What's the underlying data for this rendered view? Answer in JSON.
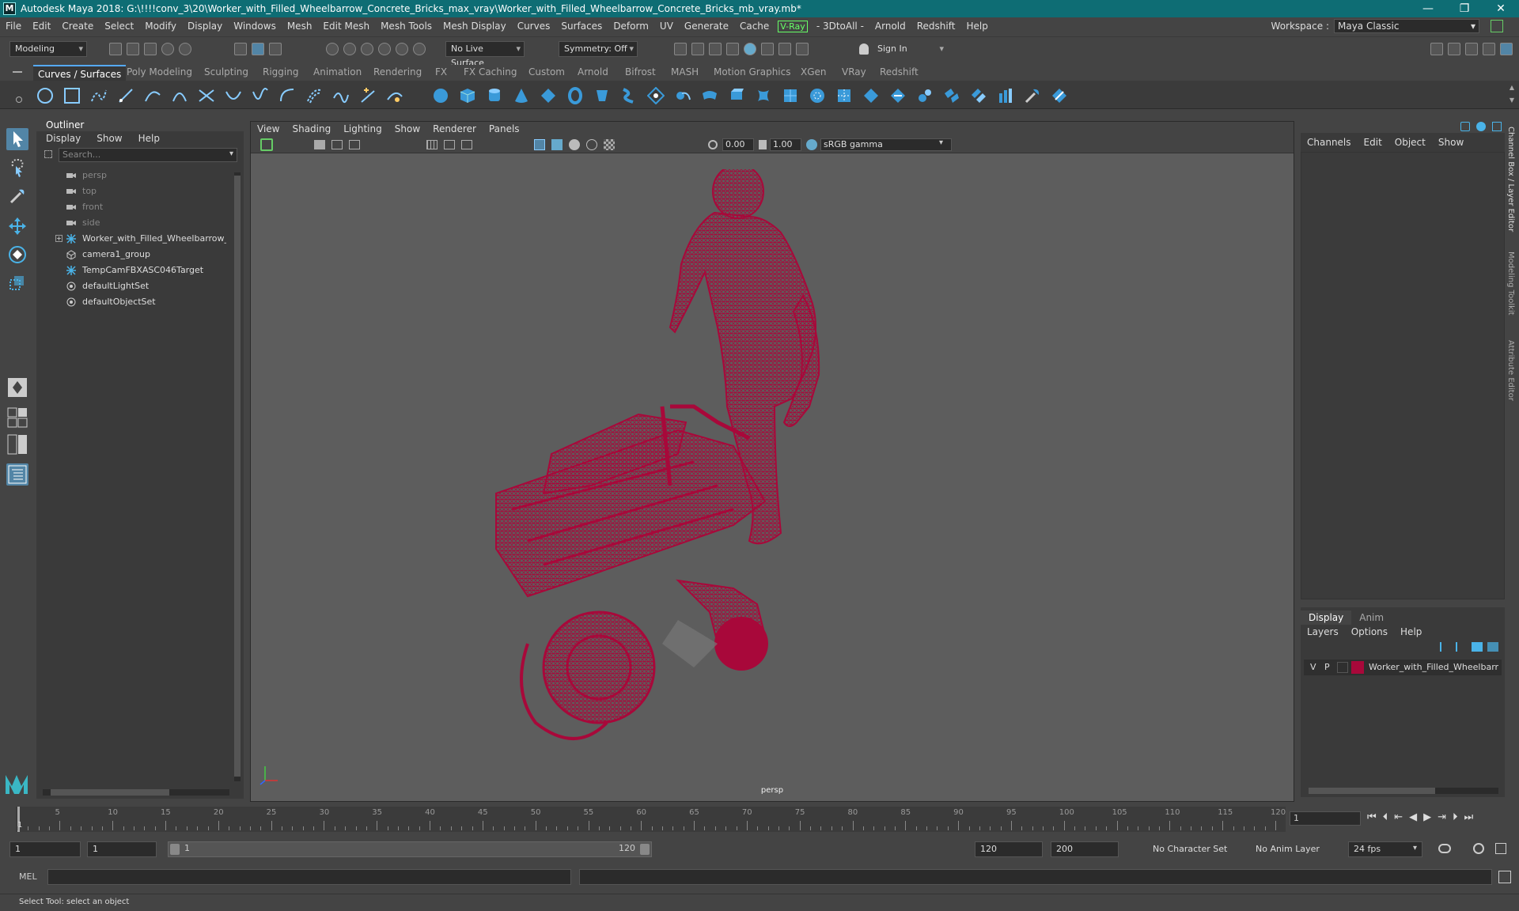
{
  "title_bar": {
    "app_icon": "M",
    "title": "Autodesk Maya 2018: G:\\!!!!conv_3\\20\\Worker_with_Filled_Wheelbarrow_Concrete_Bricks_max_vray\\Worker_with_Filled_Wheelbarrow_Concrete_Bricks_mb_vray.mb*",
    "minimize": "—",
    "maximize": "❐",
    "close": "✕"
  },
  "menu_bar": {
    "items": [
      "File",
      "Edit",
      "Create",
      "Select",
      "Modify",
      "Display",
      "Windows",
      "Mesh",
      "Edit Mesh",
      "Mesh Tools",
      "Mesh Display",
      "Curves",
      "Surfaces",
      "Deform",
      "UV",
      "Generate",
      "Cache",
      "V-Ray",
      "- 3DtoAll -",
      "Arnold",
      "Redshift",
      "Help"
    ],
    "workspace_label": "Workspace :",
    "workspace_value": "Maya Classic"
  },
  "status_line": {
    "mode": "Modeling",
    "live_surface": "No Live Surface",
    "symmetry": "Symmetry: Off",
    "sign_in": "Sign In"
  },
  "shelf": {
    "tabs": [
      "Curves / Surfaces",
      "Poly Modeling",
      "Sculpting",
      "Rigging",
      "Animation",
      "Rendering",
      "FX",
      "FX Caching",
      "Custom",
      "Arnold",
      "Bifrost",
      "MASH",
      "Motion Graphics",
      "XGen",
      "VRay",
      "Redshift"
    ],
    "active_tab": "Curves / Surfaces"
  },
  "outliner": {
    "title": "Outliner",
    "menu": [
      "Display",
      "Show",
      "Help"
    ],
    "search_placeholder": "Search...",
    "items": [
      {
        "label": "persp",
        "icon": "camera-icon",
        "dim": true
      },
      {
        "label": "top",
        "icon": "camera-icon",
        "dim": true
      },
      {
        "label": "front",
        "icon": "camera-icon",
        "dim": true
      },
      {
        "label": "side",
        "icon": "camera-icon",
        "dim": true
      },
      {
        "label": "Worker_with_Filled_Wheelbarrow_Co",
        "icon": "group-icon",
        "dim": false,
        "expandable": true
      },
      {
        "label": "camera1_group",
        "icon": "group-icon",
        "dim": false
      },
      {
        "label": "TempCamFBXASC046Target",
        "icon": "locator-icon",
        "dim": false
      },
      {
        "label": "defaultLightSet",
        "icon": "set-icon",
        "dim": false
      },
      {
        "label": "defaultObjectSet",
        "icon": "set-icon",
        "dim": false
      }
    ]
  },
  "viewport": {
    "menu": [
      "View",
      "Shading",
      "Lighting",
      "Show",
      "Renderer",
      "Panels"
    ],
    "exposure": "0.00",
    "gamma": "1.00",
    "color_space": "sRGB gamma",
    "camera_label": "persp",
    "wireframe_color": "#a8083a"
  },
  "channel_box": {
    "menu": [
      "Channels",
      "Edit",
      "Object",
      "Show"
    ]
  },
  "side_tabs": [
    "Channel Box / Layer Editor",
    "Modeling Toolkit",
    "Attribute Editor"
  ],
  "layer_editor": {
    "tabs": [
      "Display",
      "Anim"
    ],
    "active_tab": "Display",
    "menu": [
      "Layers",
      "Options",
      "Help"
    ],
    "layer": {
      "v": "V",
      "p": "P",
      "name": "Worker_with_Filled_Wheelbarr",
      "color": "#a8083a"
    }
  },
  "time_slider": {
    "ticks": [
      "5",
      "10",
      "15",
      "20",
      "25",
      "30",
      "35",
      "40",
      "45",
      "50",
      "55",
      "60",
      "65",
      "70",
      "75",
      "80",
      "85",
      "90",
      "95",
      "100",
      "105",
      "110",
      "115",
      "120"
    ],
    "start_marker": "1",
    "current_frame": "1"
  },
  "range_slider": {
    "start": "1",
    "inner_start": "1",
    "range_start": "1",
    "range_end": "120",
    "end": "120",
    "max": "200",
    "character_set": "No Character Set",
    "anim_layer": "No Anim Layer",
    "fps": "24 fps"
  },
  "command_line": {
    "label": "MEL"
  },
  "help_line": {
    "text": "Select Tool: select an object"
  }
}
